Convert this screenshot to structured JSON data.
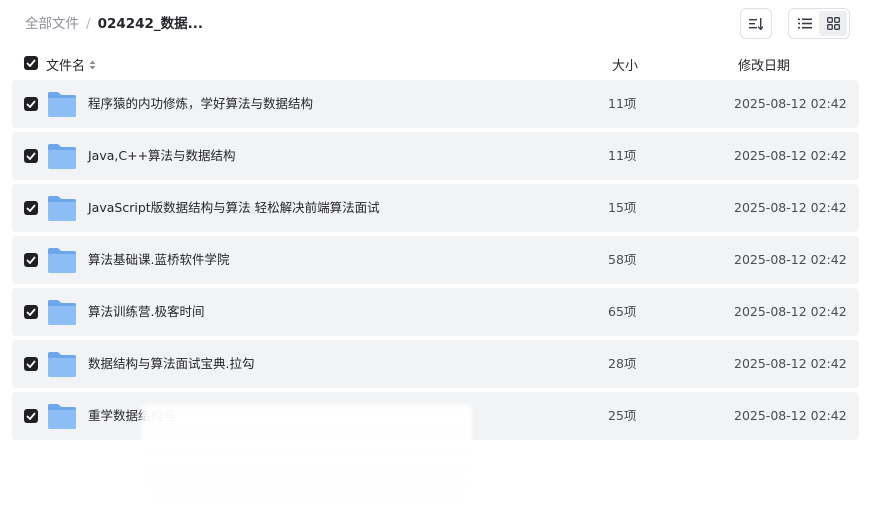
{
  "breadcrumb": {
    "root": "全部文件",
    "separator": "/",
    "current": "024242_数据..."
  },
  "toolbar": {
    "sort_icon": "sort-icon",
    "list_view_icon": "list-view-icon",
    "grid_view_icon": "grid-view-icon",
    "active_view": "list"
  },
  "columns": {
    "name": "文件名",
    "size": "大小",
    "date": "修改日期"
  },
  "files": [
    {
      "name": "程序猿的内功修炼，学好算法与数据结构",
      "size": "11项",
      "date": "2025-08-12 02:42",
      "checked": true
    },
    {
      "name": "Java,C++算法与数据结构",
      "size": "11项",
      "date": "2025-08-12 02:42",
      "checked": true
    },
    {
      "name": "JavaScript版数据结构与算法 轻松解决前端算法面试",
      "size": "15项",
      "date": "2025-08-12 02:42",
      "checked": true
    },
    {
      "name": "算法基础课.蓝桥软件学院",
      "size": "58项",
      "date": "2025-08-12 02:42",
      "checked": true
    },
    {
      "name": "算法训练营.极客时间",
      "size": "65项",
      "date": "2025-08-12 02:42",
      "checked": true
    },
    {
      "name": "数据结构与算法面试宝典.拉勾",
      "size": "28项",
      "date": "2025-08-12 02:42",
      "checked": true
    },
    {
      "name": "重学数据结构与",
      "size": "25项",
      "date": "2025-08-12 02:42",
      "checked": true
    }
  ],
  "colors": {
    "row_bg": "#f2f3f5",
    "checkbox": "#1f1f24",
    "folder": "#7fb2f0"
  }
}
